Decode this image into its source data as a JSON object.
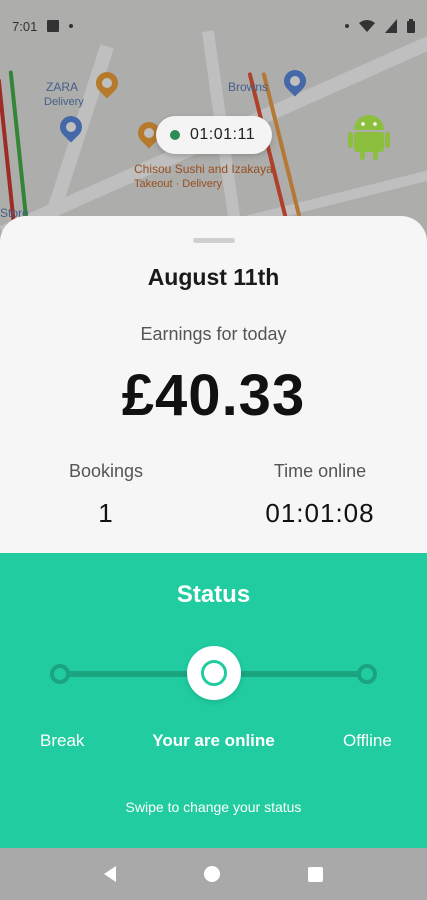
{
  "status_bar": {
    "time": "7:01"
  },
  "map": {
    "labels": [
      "ZARA",
      "Delivery",
      "Browns",
      "Chisou Sushi and Izakaya",
      "Takeout · Delivery",
      "Store"
    ]
  },
  "online_timer": "01:01:11",
  "summary": {
    "date": "August 11th",
    "earnings_label": "Earnings for today",
    "earnings_value": "£40.33",
    "bookings_label": "Bookings",
    "bookings_value": "1",
    "time_online_label": "Time online",
    "time_online_value": "01:01:08"
  },
  "status": {
    "title": "Status",
    "options": {
      "break": "Break",
      "online": "Your are online",
      "offline": "Offline"
    },
    "hint": "Swipe to change your status",
    "accent_color": "#20cca0"
  }
}
